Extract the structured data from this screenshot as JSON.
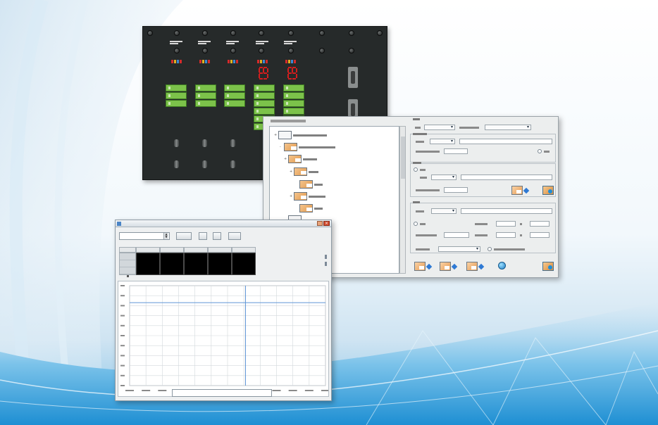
{
  "colors": {
    "accent_blue": "#2e79d4",
    "led_green": "#7cc24a",
    "led_red": "#d41e1e",
    "rack_body": "#262a2a",
    "chart_line": "#5f95d6"
  },
  "rack": {
    "label": "",
    "card_count": 5
  },
  "config": {
    "tree_title": "",
    "nodes": [
      "",
      "",
      "",
      "",
      "",
      "",
      "",
      ""
    ],
    "icons": [
      "folder-icon",
      "globe-icon",
      "save-icon",
      "diamond-arrow-icon"
    ]
  },
  "monitor": {
    "title": "",
    "datetime": "",
    "buttons": [
      "",
      "",
      "",
      ""
    ],
    "columns": [
      "",
      "",
      "",
      "",
      "",
      ""
    ],
    "row_labels": [
      "",
      "",
      ""
    ],
    "legend": ""
  },
  "chart_data": {
    "type": "line",
    "title": "",
    "xlabel": "",
    "ylabel": "",
    "x": [
      0,
      1,
      2,
      3,
      4,
      5,
      6,
      7,
      8,
      9,
      10,
      11,
      12
    ],
    "y_tick_count": 10,
    "grid": true,
    "series": [
      {
        "name": "",
        "values": [
          0.83,
          0.83,
          0.83,
          0.83,
          0.83,
          0.83,
          0.83,
          0.83,
          0.83,
          0.83,
          0.83,
          0.83,
          0.83
        ]
      }
    ],
    "marker_x": 7.1,
    "ylim": [
      0,
      1
    ]
  }
}
